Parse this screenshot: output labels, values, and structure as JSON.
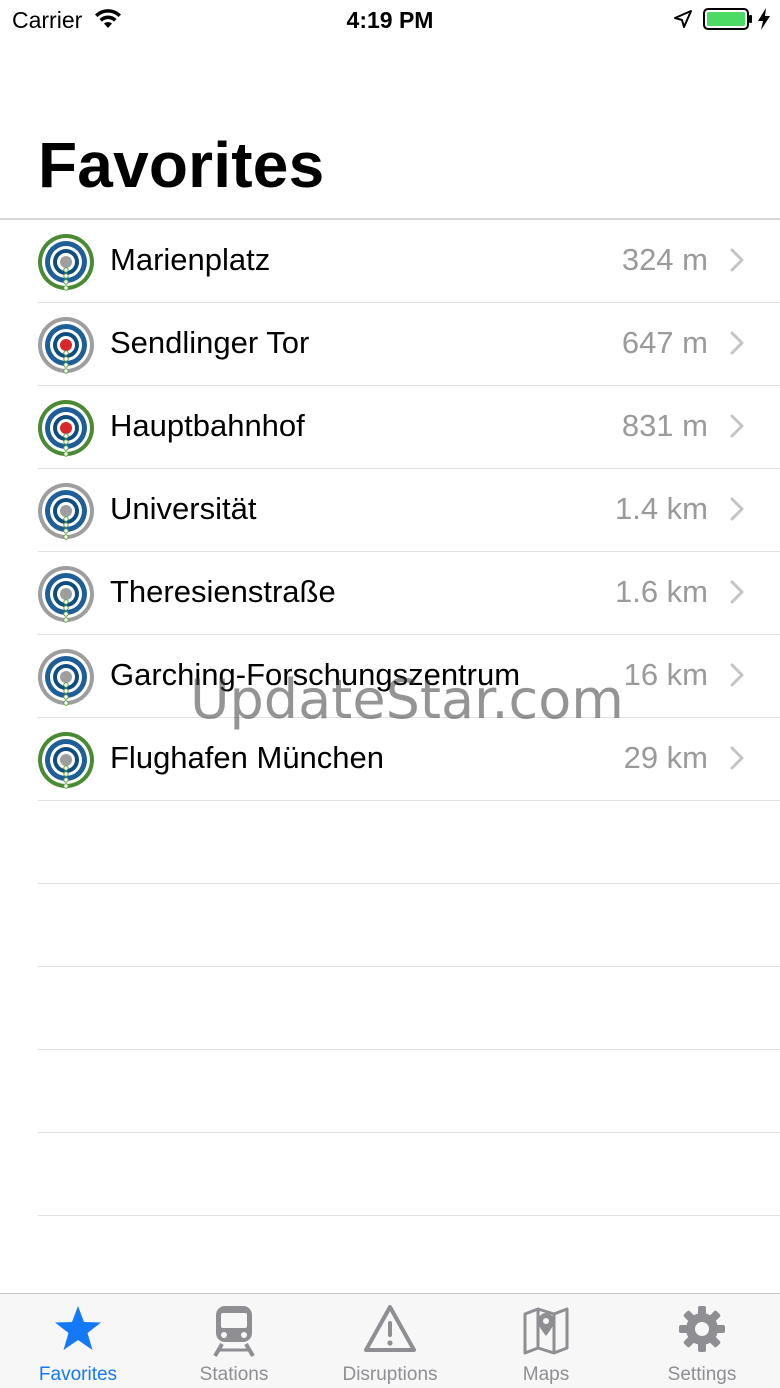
{
  "status_bar": {
    "carrier": "Carrier",
    "time": "4:19 PM",
    "battery_color": "#4cd964"
  },
  "header": {
    "title": "Favorites"
  },
  "stations": [
    {
      "name": "Marienplatz",
      "distance": "324 m",
      "ring_color": "#4a8a32",
      "center_color": "#9e9e9e"
    },
    {
      "name": "Sendlinger Tor",
      "distance": "647 m",
      "ring_color": "#9e9e9e",
      "center_color": "#d8262a"
    },
    {
      "name": "Hauptbahnhof",
      "distance": "831 m",
      "ring_color": "#4a8a32",
      "center_color": "#d8262a"
    },
    {
      "name": "Universität",
      "distance": "1.4 km",
      "ring_color": "#9e9e9e",
      "center_color": "#9e9e9e"
    },
    {
      "name": "Theresienstraße",
      "distance": "1.6 km",
      "ring_color": "#9e9e9e",
      "center_color": "#9e9e9e"
    },
    {
      "name": "Garching-Forschungszentrum",
      "distance": "16 km",
      "ring_color": "#9e9e9e",
      "center_color": "#9e9e9e"
    },
    {
      "name": "Flughafen München",
      "distance": "29 km",
      "ring_color": "#4a8a32",
      "center_color": "#9e9e9e"
    }
  ],
  "watermark": "UpdateStar.com",
  "tabs": [
    {
      "label": "Favorites",
      "icon": "star-icon",
      "active": true
    },
    {
      "label": "Stations",
      "icon": "train-icon",
      "active": false
    },
    {
      "label": "Disruptions",
      "icon": "warning-icon",
      "active": false
    },
    {
      "label": "Maps",
      "icon": "map-icon",
      "active": false
    },
    {
      "label": "Settings",
      "icon": "gear-icon",
      "active": false
    }
  ],
  "colors": {
    "accent": "#1479f6",
    "inactive": "#8e8e93",
    "secondary_text": "#9a9a9a"
  }
}
